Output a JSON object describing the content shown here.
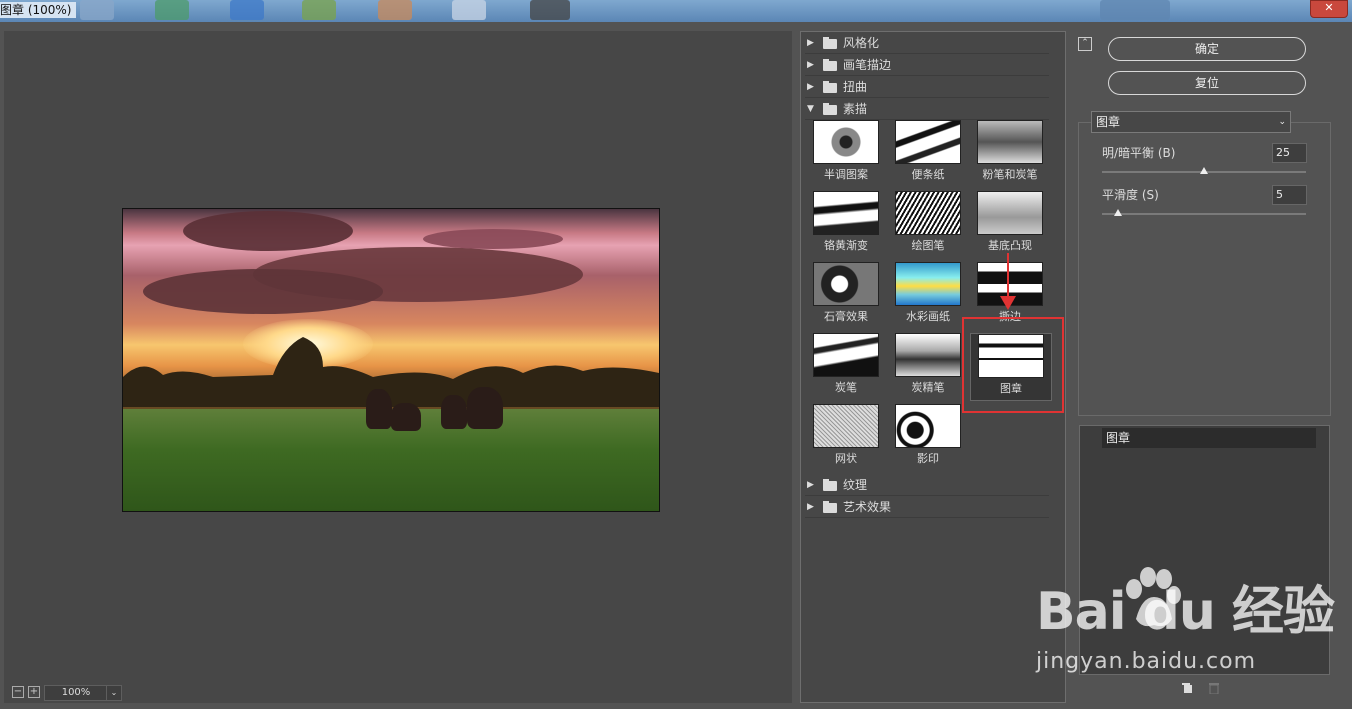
{
  "window": {
    "title": "图章 (100%)"
  },
  "preview": {
    "zoom": "100%",
    "zoom_out": "−",
    "zoom_in": "+"
  },
  "gallery": {
    "categories_top": [
      {
        "label": "风格化",
        "expanded": false
      },
      {
        "label": "画笔描边",
        "expanded": false
      },
      {
        "label": "扭曲",
        "expanded": false
      },
      {
        "label": "素描",
        "expanded": true
      }
    ],
    "thumbnails": [
      {
        "label": "半调图案"
      },
      {
        "label": "便条纸"
      },
      {
        "label": "粉笔和炭笔"
      },
      {
        "label": "铬黄渐变"
      },
      {
        "label": "绘图笔"
      },
      {
        "label": "基底凸现"
      },
      {
        "label": "石膏效果"
      },
      {
        "label": "水彩画纸"
      },
      {
        "label": "撕边"
      },
      {
        "label": "炭笔"
      },
      {
        "label": "炭精笔"
      },
      {
        "label": "图章"
      },
      {
        "label": "网状"
      },
      {
        "label": "影印"
      }
    ],
    "selected": "图章",
    "categories_bottom": [
      {
        "label": "纹理",
        "expanded": false
      },
      {
        "label": "艺术效果",
        "expanded": false
      }
    ]
  },
  "controls": {
    "ok_label": "确定",
    "reset_label": "复位",
    "filter_select": "图章",
    "params": [
      {
        "label": "明/暗平衡 (B)",
        "value": "25",
        "fraction": 0.5
      },
      {
        "label": "平滑度 (S)",
        "value": "5",
        "fraction": 0.08
      }
    ],
    "layer_name": "图章"
  },
  "watermark": {
    "brand": "Bai du 经验",
    "url": "jingyan.baidu.com"
  },
  "colors": {
    "highlight": "#e03333",
    "panel": "#535353",
    "preview_bg": "#474747"
  }
}
